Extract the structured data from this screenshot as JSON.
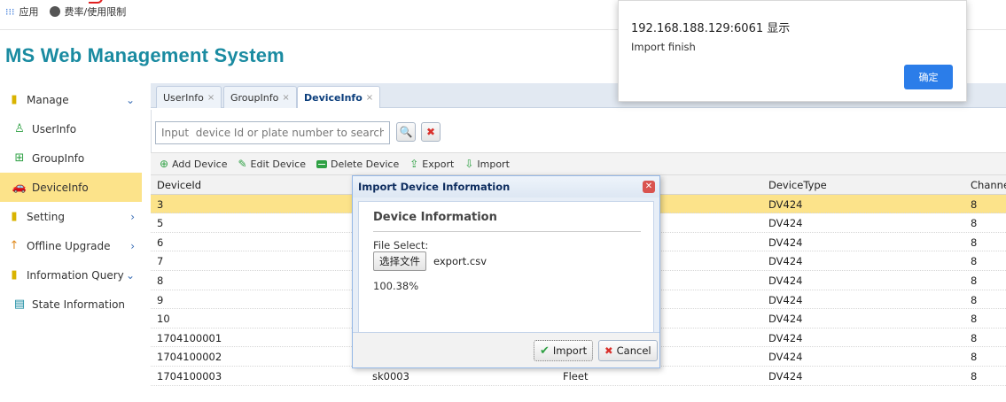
{
  "bookmarks": {
    "apps": "应用",
    "rates": "费率/使用限制"
  },
  "app_title": "MS Web Management System",
  "sidebar": {
    "items": [
      {
        "label": "Manage",
        "icon": "manage-icon",
        "chevron": "⌄"
      },
      {
        "label": "UserInfo",
        "icon": "user-icon"
      },
      {
        "label": "GroupInfo",
        "icon": "group-icon"
      },
      {
        "label": "DeviceInfo",
        "icon": "car-icon"
      },
      {
        "label": "Setting",
        "icon": "setting-icon",
        "chevron": "›"
      },
      {
        "label": "Offline Upgrade",
        "icon": "upgrade-icon",
        "chevron": "›"
      },
      {
        "label": "Information Query",
        "icon": "query-icon",
        "chevron": "⌄"
      },
      {
        "label": "State Information",
        "icon": "state-icon"
      }
    ]
  },
  "tabs": [
    {
      "label": "UserInfo"
    },
    {
      "label": "GroupInfo"
    },
    {
      "label": "DeviceInfo"
    }
  ],
  "search": {
    "placeholder": "Input  device Id or plate number to search"
  },
  "toolbar": {
    "add": "Add Device",
    "edit": "Edit Device",
    "delete": "Delete Device",
    "export": "Export",
    "import": "Import"
  },
  "table": {
    "headers": [
      "DeviceId",
      "",
      "",
      "DeviceType",
      "Channe"
    ],
    "rows": [
      [
        "3",
        "",
        "",
        "DV424",
        "8"
      ],
      [
        "5",
        "",
        "",
        "DV424",
        "8"
      ],
      [
        "6",
        "",
        "",
        "DV424",
        "8"
      ],
      [
        "7",
        "",
        "",
        "DV424",
        "8"
      ],
      [
        "8",
        "",
        "",
        "DV424",
        "8"
      ],
      [
        "9",
        "",
        "",
        "DV424",
        "8"
      ],
      [
        "10",
        "",
        "",
        "DV424",
        "8"
      ],
      [
        "1704100001",
        "",
        "",
        "DV424",
        "8"
      ],
      [
        "1704100002",
        "",
        "",
        "DV424",
        "8"
      ],
      [
        "1704100003",
        "sk0003",
        "Fleet",
        "DV424",
        "8"
      ]
    ]
  },
  "dialog": {
    "title": "Import Device Information",
    "section": "Device Information",
    "file_label": "File Select:",
    "file_button": "选择文件",
    "file_name": "export.csv",
    "progress": "100.38%",
    "import_label": "Import",
    "cancel_label": "Cancel"
  },
  "alert": {
    "title": "192.168.188.129:6061 显示",
    "message": "Import finish",
    "ok": "确定"
  },
  "colors": {
    "accent": "#1a8ba1",
    "selected_row": "#fce38a",
    "alert_button": "#2b7de9"
  }
}
